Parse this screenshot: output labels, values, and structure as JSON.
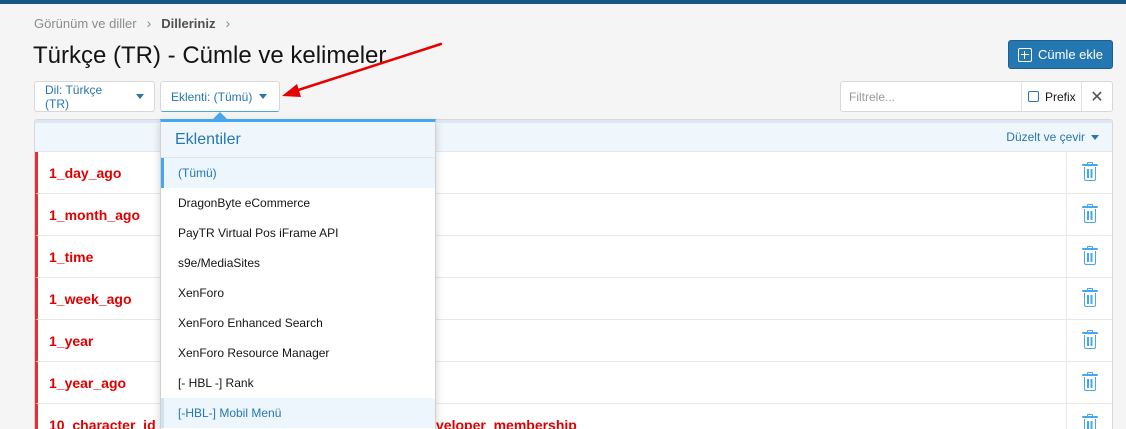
{
  "breadcrumb": [
    "Görünüm ve diller",
    "Dilleriniz"
  ],
  "page_title": "Türkçe (TR) - Cümle ve kelimeler",
  "add_button": {
    "label": "Cümle ekle",
    "icon": "plus-square-icon"
  },
  "filters": {
    "language_label": "Dil: Türkçe (TR)",
    "addon_label": "Eklenti: (Tümü)",
    "filter_placeholder": "Filtrele...",
    "prefix_label": "Prefix",
    "clear_symbol": "✕"
  },
  "list_header": {
    "edit_label": "Düzelt ve çevir"
  },
  "phrases": [
    {
      "key": "1_day_ago",
      "extra": ""
    },
    {
      "key": "1_month_ago",
      "extra": ""
    },
    {
      "key": "1_time",
      "extra": ""
    },
    {
      "key": "1_week_ago",
      "extra": ""
    },
    {
      "key": "1_year",
      "extra": ""
    },
    {
      "key": "1_year_ago",
      "extra": ""
    },
    {
      "key": "10_character_id",
      "extra": "veloper_membership"
    }
  ],
  "dropdown": {
    "title": "Eklentiler",
    "items": [
      "(Tümü)",
      "DragonByte eCommerce",
      "PayTR Virtual Pos iFrame API",
      "s9e/MediaSites",
      "XenForo",
      "XenForo Enhanced Search",
      "XenForo Resource Manager",
      "[- HBL -] Rank",
      "[-HBL-] Mobil Menü"
    ],
    "selected_index": 0,
    "hovered_index": 8
  },
  "colors": {
    "accent": "#2577b1",
    "phrase_red": "#e00000",
    "annotation_arrow": "#e60000"
  }
}
